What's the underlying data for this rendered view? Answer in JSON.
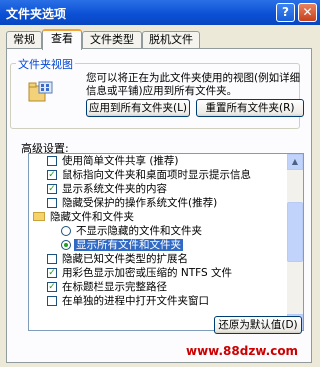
{
  "window": {
    "title": "文件夹选项",
    "help_label": "?",
    "close_label": "✕"
  },
  "tabs": [
    {
      "label": "常规"
    },
    {
      "label": "查看",
      "active": true
    },
    {
      "label": "文件类型"
    },
    {
      "label": "脱机文件"
    }
  ],
  "folder_view": {
    "legend": "文件夹视图",
    "description": "您可以将正在为此文件夹使用的视图(例如详细信息或平铺)应用到所有文件夹。",
    "apply_button": "应用到所有文件夹(L)",
    "reset_button": "重置所有文件夹(R)",
    "icon": "folder-view-icon"
  },
  "advanced": {
    "label": "高级设置:",
    "items": [
      {
        "type": "checkbox",
        "checked": false,
        "label": "使用简单文件共享 (推荐)"
      },
      {
        "type": "checkbox",
        "checked": true,
        "label": "鼠标指向文件夹和桌面项时显示提示信息"
      },
      {
        "type": "checkbox",
        "checked": true,
        "label": "显示系统文件夹的内容"
      },
      {
        "type": "checkbox",
        "checked": false,
        "label": "隐藏受保护的操作系统文件(推荐)"
      },
      {
        "type": "folder",
        "label": "隐藏文件和文件夹"
      },
      {
        "type": "radio",
        "checked": false,
        "label": "不显示隐藏的文件和文件夹"
      },
      {
        "type": "radio",
        "checked": true,
        "selected": true,
        "label": "显示所有文件和文件夹"
      },
      {
        "type": "checkbox",
        "checked": false,
        "label": "隐藏已知文件类型的扩展名"
      },
      {
        "type": "checkbox",
        "checked": true,
        "label": "用彩色显示加密或压缩的 NTFS 文件"
      },
      {
        "type": "checkbox",
        "checked": true,
        "label": "在标题栏显示完整路径"
      },
      {
        "type": "checkbox",
        "checked": false,
        "label": "在单独的进程中打开文件夹窗口"
      }
    ]
  },
  "restore_button": "还原为默认值(D)",
  "watermark": "www.88dzw.com"
}
